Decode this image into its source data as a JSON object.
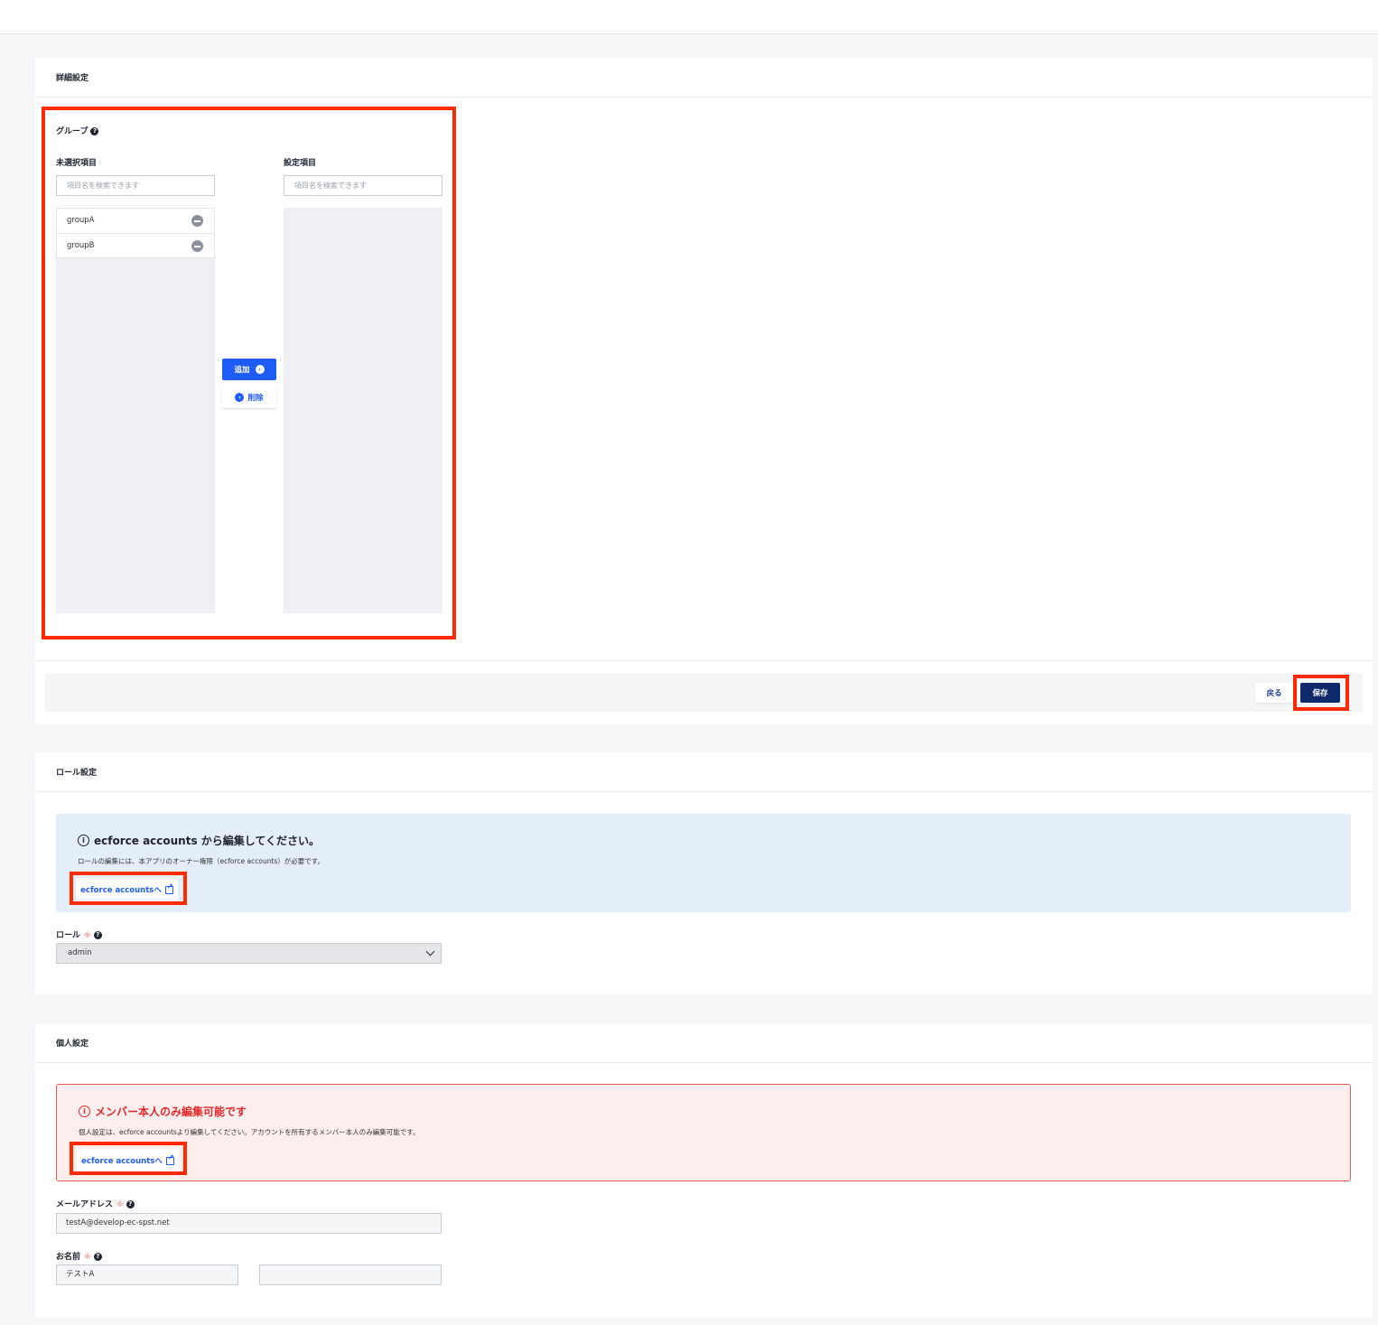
{
  "detail": {
    "title": "詳細設定",
    "group_label": "グループ",
    "unselected_label": "未選択項目",
    "selected_label": "設定項目",
    "search_placeholder": "項目名を検索できます",
    "unselected_items": [
      {
        "label": "groupA"
      },
      {
        "label": "groupB"
      }
    ],
    "add_label": "追加",
    "delete_label": "削除",
    "back_label": "戻る",
    "save_label": "保存"
  },
  "role": {
    "title": "ロール設定",
    "info_title": "ecforce accounts から編集してください。",
    "info_desc": "ロールの編集には、本アプリのオーナー権限（ecforce accounts）が必要です。",
    "link_label": "ecforce accountsへ",
    "field_label": "ロール",
    "required_mark": "※",
    "selected_value": "admin"
  },
  "personal": {
    "title": "個人設定",
    "warn_title": "メンバー本人のみ編集可能です",
    "warn_desc": "個人設定は、ecforce accountsより編集してください。アカウントを所有するメンバー本人のみ編集可能です。",
    "link_label": "ecforce accountsへ",
    "email_label": "メールアドレス",
    "email_value": "testA@develop-ec-spst.net",
    "name_label": "お名前",
    "last_name_value": "テストA",
    "first_name_value": "",
    "required_mark": "※"
  },
  "colors": {
    "accent": "#1e5cf5",
    "save": "#0f2a6b",
    "highlight": "#ff2a00",
    "warn": "#e02a2a"
  }
}
